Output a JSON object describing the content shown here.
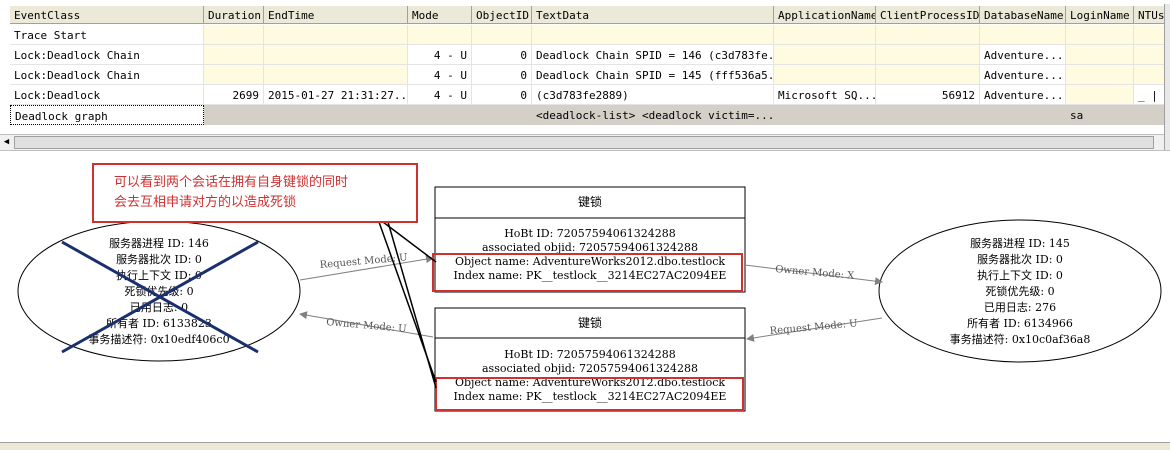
{
  "trace": {
    "columns": [
      "EventClass",
      "Duration",
      "EndTime",
      "Mode",
      "ObjectID",
      "TextData",
      "ApplicationName",
      "ClientProcessID",
      "DatabaseName",
      "LoginName",
      "NTUserN"
    ],
    "rows": [
      {
        "EventClass": "Trace Start",
        "Duration": "",
        "EndTime": "",
        "Mode": "",
        "ObjectID": "",
        "TextData": "",
        "ApplicationName": "",
        "ClientProcessID": "",
        "DatabaseName": "",
        "LoginName": "",
        "NTUserN": ""
      },
      {
        "EventClass": "Lock:Deadlock Chain",
        "Duration": "",
        "EndTime": "",
        "Mode": "4 - U",
        "ObjectID": "0",
        "TextData": "Deadlock Chain SPID = 146 (c3d783fe...",
        "ApplicationName": "",
        "ClientProcessID": "",
        "DatabaseName": "Adventure...",
        "LoginName": "",
        "NTUserN": ""
      },
      {
        "EventClass": "Lock:Deadlock Chain",
        "Duration": "",
        "EndTime": "",
        "Mode": "4 - U",
        "ObjectID": "0",
        "TextData": "Deadlock Chain SPID = 145 (fff536a5...",
        "ApplicationName": "",
        "ClientProcessID": "",
        "DatabaseName": "Adventure...",
        "LoginName": "",
        "NTUserN": ""
      },
      {
        "EventClass": "Lock:Deadlock",
        "Duration": "2699",
        "EndTime": "2015-01-27 21:31:27...",
        "Mode": "4 - U",
        "ObjectID": "0",
        "TextData": "(c3d783fe2889)",
        "ApplicationName": "Microsoft SQ...",
        "ClientProcessID": "56912",
        "DatabaseName": "Adventure...",
        "LoginName": "",
        "NTUserN": "_ |"
      },
      {
        "EventClass": "Deadlock graph",
        "Duration": "",
        "EndTime": "",
        "Mode": "",
        "ObjectID": "",
        "TextData": "<deadlock-list>  <deadlock victim=...",
        "ApplicationName": "",
        "ClientProcessID": "",
        "DatabaseName": "",
        "LoginName": "sa",
        "NTUserN": ""
      }
    ]
  },
  "annotation": {
    "line1": "可以看到两个会话在拥有自身键锁的同时",
    "line2": "会去互相申请对方的以造成死锁"
  },
  "graph": {
    "process_left": {
      "lines": [
        "服务器进程 ID: 146",
        "服务器批次 ID: 0",
        "执行上下文 ID: 0",
        "死锁优先级: 0",
        "已用日志: 0",
        "所有者 ID: 6133823",
        "事务描述符: 0x10edf406c0"
      ],
      "victim": true
    },
    "process_right": {
      "lines": [
        "服务器进程 ID: 145",
        "服务器批次 ID: 0",
        "执行上下文 ID: 0",
        "死锁优先级: 0",
        "已用日志: 276",
        "所有者 ID: 6134966",
        "事务描述符: 0x10c0af36a8"
      ],
      "victim": false
    },
    "key_lock_top": {
      "title": "键锁",
      "hobt": "HoBt ID: 72057594061324288",
      "objid": "associated objid: 72057594061324288",
      "object": "Object name: AdventureWorks2012.dbo.testlock",
      "index": "Index name: PK__testlock__3214EC27AC2094EE"
    },
    "key_lock_bottom": {
      "title": "键锁",
      "hobt": "HoBt ID: 72057594061324288",
      "objid": "associated objid: 72057594061324288",
      "object": "Object name: AdventureWorks2012.dbo.testlock",
      "index": "Index name: PK__testlock__3214EC27AC2094EE"
    },
    "edges": {
      "left_request": "Request Mode: U",
      "right_owner": "Owner Mode: X",
      "left_owner": "Owner Mode: U",
      "right_request": "Request Mode: U"
    }
  },
  "colors": {
    "highlight": "#d03030",
    "victim_cross": "#1a2f6e",
    "header_bg": "#ece9d8"
  }
}
